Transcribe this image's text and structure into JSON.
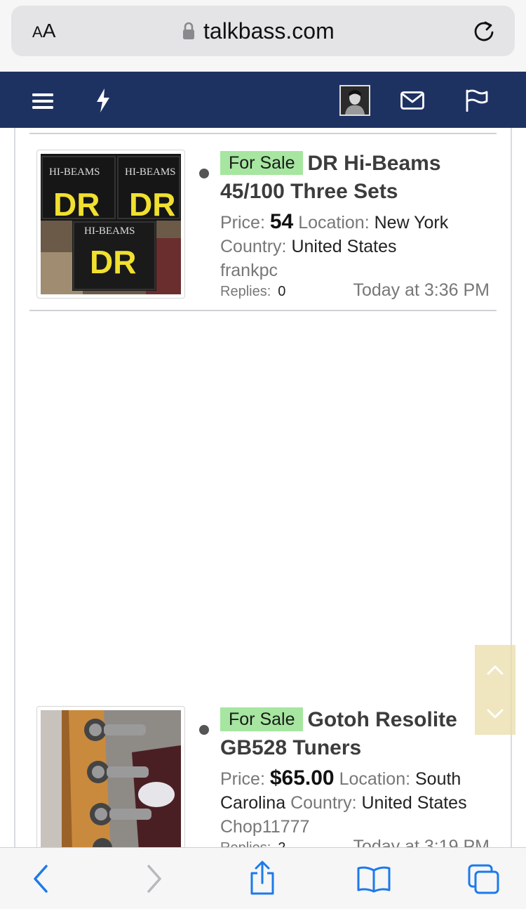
{
  "browser": {
    "aa_label_small": "A",
    "aa_label_large": "A",
    "url": "talkbass.com"
  },
  "site_nav": {
    "icons": [
      "menu-icon",
      "lightning-icon",
      "avatar",
      "mail-icon",
      "flag-icon"
    ]
  },
  "listings": [
    {
      "badge": "For Sale",
      "title": "DR Hi-Beams 45/100 Three Sets",
      "price_label": "Price:",
      "price": "54",
      "location_label": "Location:",
      "location": "New York",
      "country_label": "Country:",
      "country": "United States",
      "user": "frankpc",
      "replies_label": "Replies:",
      "replies": "0",
      "time": "Today at 3:36 PM"
    },
    {
      "badge": "For Sale",
      "title": "Gotoh Resolite GB528 Tuners",
      "price_label": "Price:",
      "price": "$65.00",
      "location_label": "Location:",
      "location": "South Carolina",
      "country_label": "Country:",
      "country": "United States",
      "user": "Chop11777",
      "replies_label": "Replies:",
      "replies": "2",
      "time": "Today at 3:19 PM"
    }
  ],
  "image_text": {
    "dr_brand": "DR",
    "dr_line": "HI-BEAMS"
  },
  "toolbar": {
    "icons": [
      "back-icon",
      "forward-icon",
      "share-icon",
      "bookmarks-icon",
      "tabs-icon"
    ]
  }
}
